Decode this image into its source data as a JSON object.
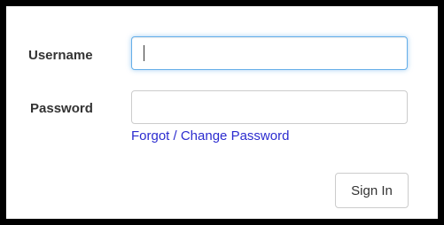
{
  "login_form": {
    "username_label": "Username",
    "username_value": "",
    "password_label": "Password",
    "password_value": "",
    "forgot_link": "Forgot / Change Password",
    "sign_in_button": "Sign In"
  },
  "colors": {
    "link": "#2b2bcf",
    "focus_border": "#66afe9",
    "label_text": "#333333",
    "frame_border": "#000000"
  }
}
